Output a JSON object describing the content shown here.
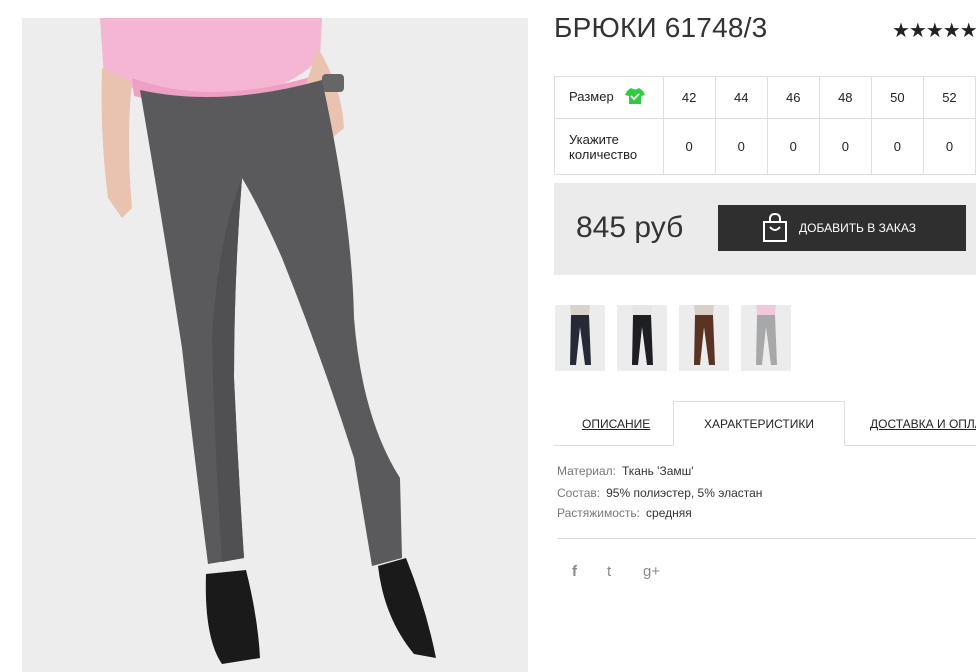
{
  "product": {
    "title": "БРЮКИ 61748/3",
    "rating_stars": "★★★★★"
  },
  "sizes": {
    "size_label": "Размер",
    "qty_label_1": "Укажите",
    "qty_label_2": "количество",
    "values": [
      "42",
      "44",
      "46",
      "48",
      "50",
      "52"
    ],
    "quantities": [
      "0",
      "0",
      "0",
      "0",
      "0",
      "0"
    ]
  },
  "buy": {
    "price": "845 руб",
    "add_label": "ДОБАВИТЬ В ЗАКАЗ"
  },
  "tabs": {
    "description": "ОПИСАНИЕ",
    "characteristics": "ХАРАКТЕРИСТИКИ",
    "delivery": "ДОСТАВКА И ОПЛАТА"
  },
  "specs": [
    {
      "key": "Материал:",
      "value": "Ткань 'Замш'"
    },
    {
      "key": "Состав:",
      "value": "95% полиэстер, 5% эластан"
    },
    {
      "key": "Растяжимость:",
      "value": "средняя"
    }
  ],
  "social": {
    "facebook": "f",
    "twitter": "t",
    "googleplus": "g+"
  },
  "colors": {
    "pants_main": "#5a5a5c",
    "sweater": "#f4b6d2",
    "btn": "#2f2f2f",
    "size_icon": "#2ecc40"
  }
}
